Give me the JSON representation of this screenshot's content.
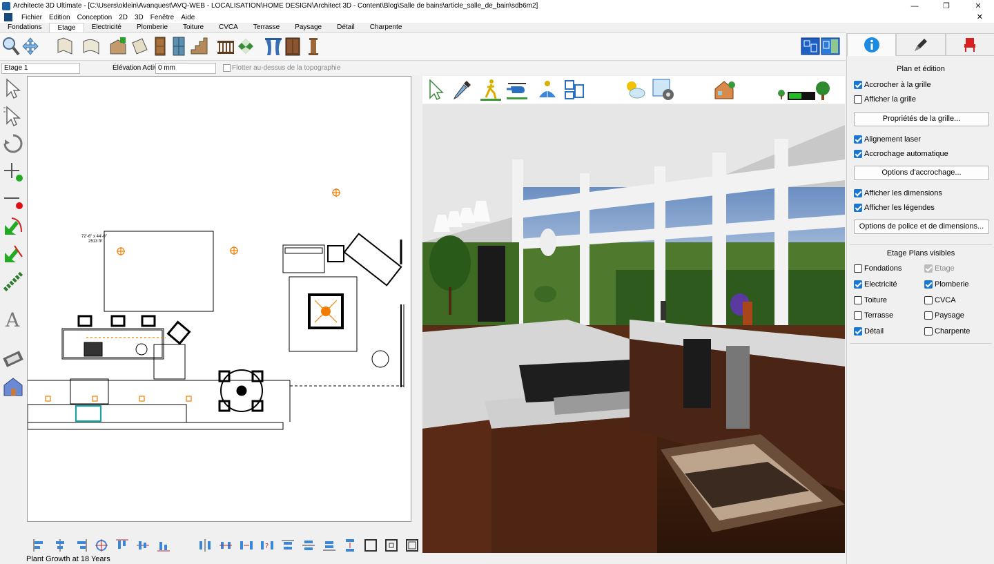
{
  "window": {
    "title": "Architecte 3D Ultimate - [C:\\Users\\oklein\\Avanquest\\AVQ-WEB - LOCALISATION\\HOME DESIGN\\Architect 3D - Content\\Blog\\Salle de bains\\article_salle_de_bain\\sdb6m2]",
    "minimize": "—",
    "maximize": "❐",
    "close": "✕",
    "doc_close": "✕"
  },
  "menu": [
    "Fichier",
    "Edition",
    "Conception",
    "2D",
    "3D",
    "Fenêtre",
    "Aide"
  ],
  "ribbon_tabs": [
    "Fondations",
    "Etage",
    "Electricité",
    "Plomberie",
    "Toiture",
    "CVCA",
    "Terrasse",
    "Paysage",
    "Détail",
    "Charpente"
  ],
  "ribbon_active": "Etage",
  "levelbar": {
    "level": "Etage 1",
    "elevation_label": "Élévation Active:",
    "elevation_value": "0 mm",
    "float_label": "Flotter au-dessus de la topographie"
  },
  "plan": {
    "room_label_1": "72'-6\" x 44'-0\"",
    "room_label_2": "2513 ft²"
  },
  "statusbar": "Plant Growth at 18 Years",
  "panel": {
    "section1_title": "Plan et édition",
    "snap_grid": "Accrocher à la grille",
    "show_grid": "Afficher la grille",
    "grid_props": "Propriétés de la grille...",
    "laser": "Alignement laser",
    "auto_snap": "Accrochage automatique",
    "snap_options": "Options d'accrochage...",
    "show_dims": "Afficher les dimensions",
    "show_legends": "Afficher les légendes",
    "font_options": "Options de police et de dimensions...",
    "section2_title": "Etage Plans visibles",
    "layers": [
      {
        "label": "Fondations",
        "checked": false,
        "disabled": false
      },
      {
        "label": "Etage",
        "checked": true,
        "disabled": true
      },
      {
        "label": "Electricité",
        "checked": true,
        "disabled": false
      },
      {
        "label": "Plomberie",
        "checked": true,
        "disabled": false
      },
      {
        "label": "Toiture",
        "checked": false,
        "disabled": false
      },
      {
        "label": "CVCA",
        "checked": false,
        "disabled": false
      },
      {
        "label": "Terrasse",
        "checked": false,
        "disabled": false
      },
      {
        "label": "Paysage",
        "checked": false,
        "disabled": false
      },
      {
        "label": "Détail",
        "checked": true,
        "disabled": false
      },
      {
        "label": "Charpente",
        "checked": false,
        "disabled": false
      }
    ]
  },
  "colors": {
    "accent": "#1976d2",
    "snap_marker": "#f07d00",
    "selected_handle": "#f07d00",
    "info_tab_icon": "#1a8be0",
    "chair_tab_icon": "#d92020"
  }
}
